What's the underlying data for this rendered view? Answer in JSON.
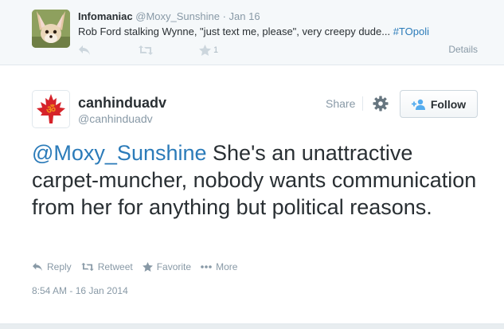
{
  "parent_tweet": {
    "name": "Infomaniac",
    "handle": "@Moxy_Sunshine",
    "separator": "·",
    "date": "Jan 16",
    "text": "Rob Ford stalking Wynne, \"just text me, please\", very creepy dude... ",
    "hashtag": "#TOpoli",
    "favorite_count": "1",
    "details_label": "Details"
  },
  "tweet": {
    "display_name": "canhinduadv",
    "screen_name": "@canhinduadv",
    "mention": "@Moxy_Sunshine",
    "text": " She's an unattractive carpet-muncher, nobody wants communication from her for anything but political reasons.",
    "timestamp": "8:54 AM - 16 Jan 2014"
  },
  "header_actions": {
    "share_label": "Share",
    "follow_label": "Follow"
  },
  "actions": {
    "reply_label": "Reply",
    "retweet_label": "Retweet",
    "favorite_label": "Favorite",
    "more_label": "More"
  },
  "colors": {
    "link": "#2b7bb9",
    "muted": "#8899a6",
    "maple_red": "#d6232a",
    "om_orange": "#f28c1a"
  },
  "icons": [
    "reply-icon",
    "retweet-icon",
    "star-icon",
    "gear-icon",
    "add-person-icon",
    "maple-leaf-om-avatar",
    "fennec-fox-avatar",
    "more-dots-icon"
  ]
}
